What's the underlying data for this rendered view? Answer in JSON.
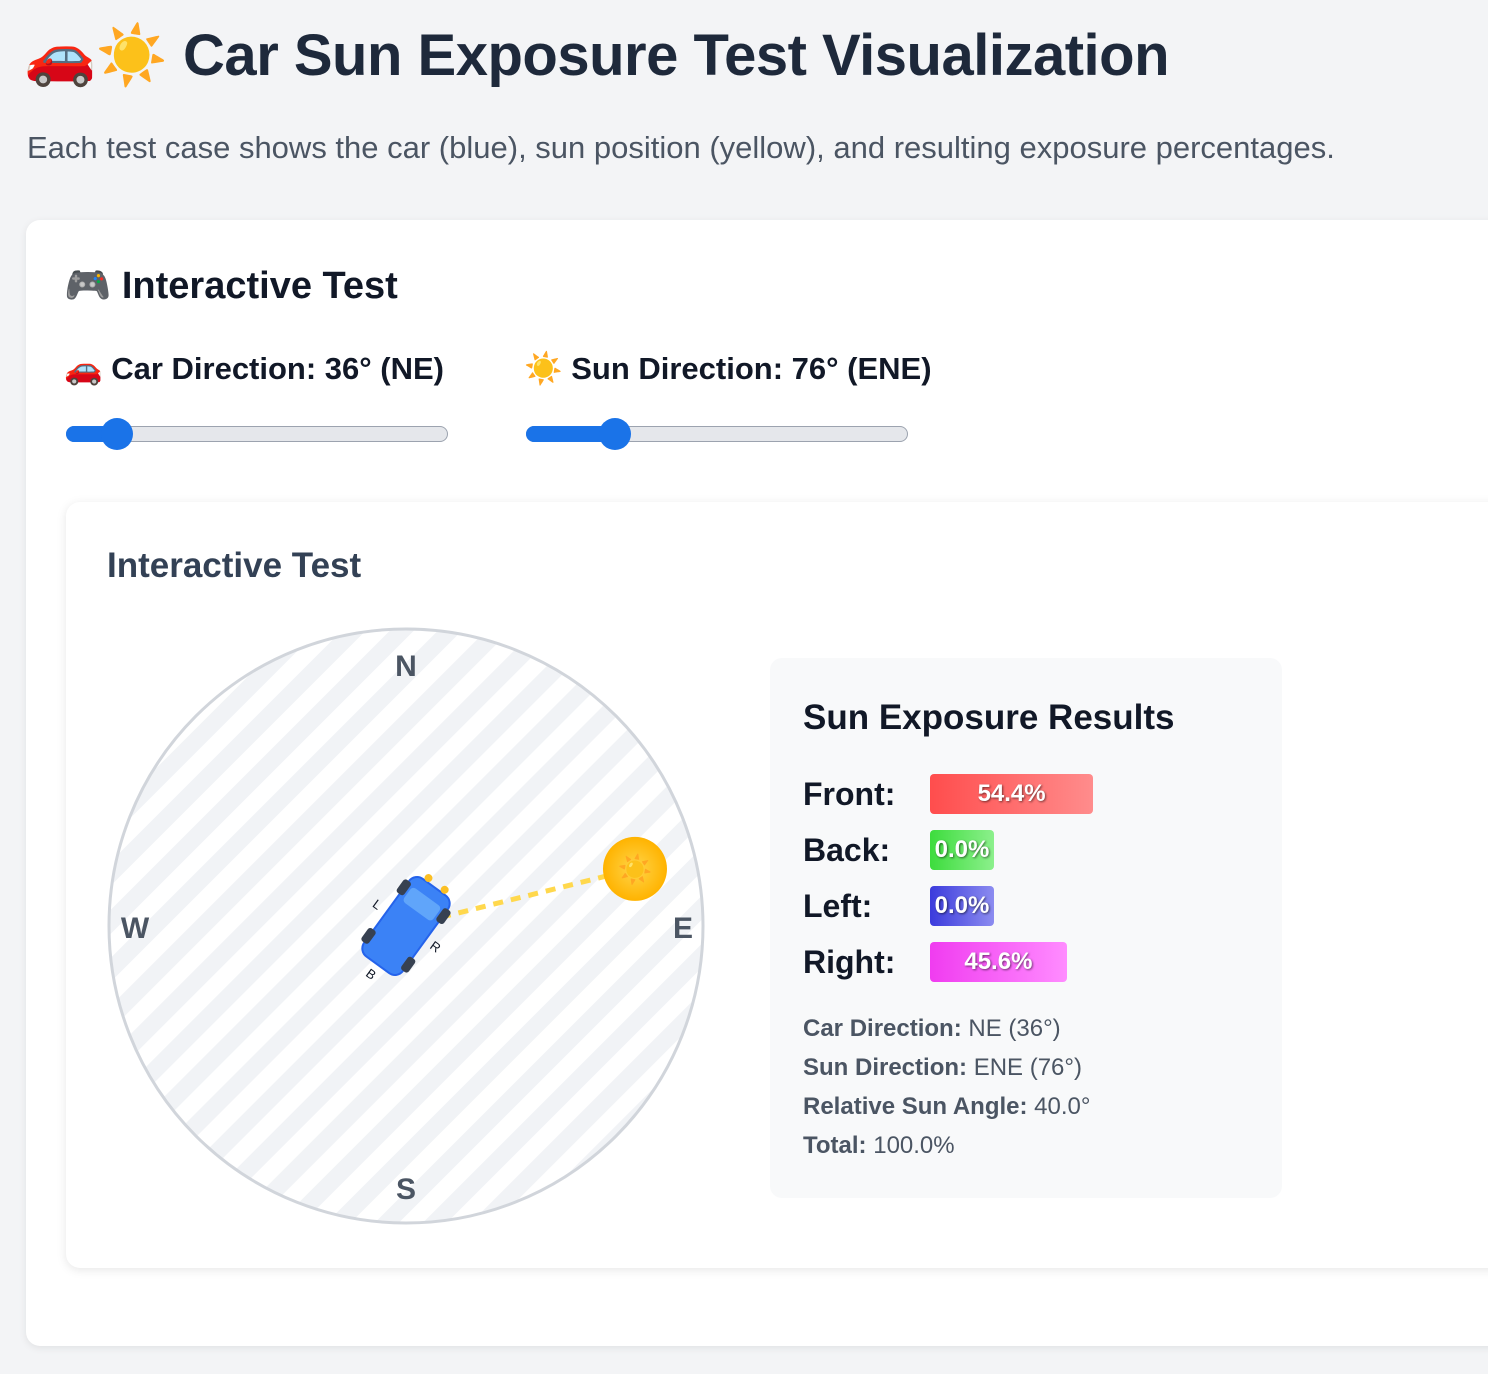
{
  "header": {
    "title": "🚗☀️ Car Sun Exposure Test Visualization",
    "subtitle": "Each test case shows the car (blue), sun position (yellow), and resulting exposure percentages."
  },
  "interactive": {
    "section_title": "🎮 Interactive Test",
    "car_control": {
      "label": "🚗 Car Direction: 36° (NE)",
      "value_deg": 36,
      "max_deg": 360
    },
    "sun_control": {
      "label": "☀️ Sun Direction: 76° (ENE)",
      "value_deg": 76,
      "max_deg": 360
    }
  },
  "test_card": {
    "title": "Interactive Test",
    "compass": {
      "north": "N",
      "east": "E",
      "south": "S",
      "west": "W",
      "car_heading_deg": 36,
      "sun_azimuth_deg": 76,
      "car_side_labels": {
        "left": "L",
        "right": "R",
        "back": "B"
      },
      "sun_glyph": "☀️"
    },
    "results": {
      "title": "Sun Exposure Results",
      "rows": [
        {
          "label": "Front:",
          "value": "54.4%",
          "percent": 54.4,
          "color_from": "#ff4d4d",
          "color_to": "#ff8c8c"
        },
        {
          "label": "Back:",
          "value": "0.0%",
          "percent": 0.0,
          "color_from": "#3ddc3d",
          "color_to": "#8cf08c"
        },
        {
          "label": "Left:",
          "value": "0.0%",
          "percent": 0.0,
          "color_from": "#3b3bdc",
          "color_to": "#8c8cf0"
        },
        {
          "label": "Right:",
          "value": "45.6%",
          "percent": 45.6,
          "color_from": "#f03cf0",
          "color_to": "#ff8cff"
        }
      ],
      "info": [
        {
          "label": "Car Direction:",
          "value": "NE (36°)"
        },
        {
          "label": "Sun Direction:",
          "value": "ENE (76°)"
        },
        {
          "label": "Relative Sun Angle:",
          "value": "40.0°"
        },
        {
          "label": "Total:",
          "value": "100.0%"
        }
      ]
    }
  }
}
